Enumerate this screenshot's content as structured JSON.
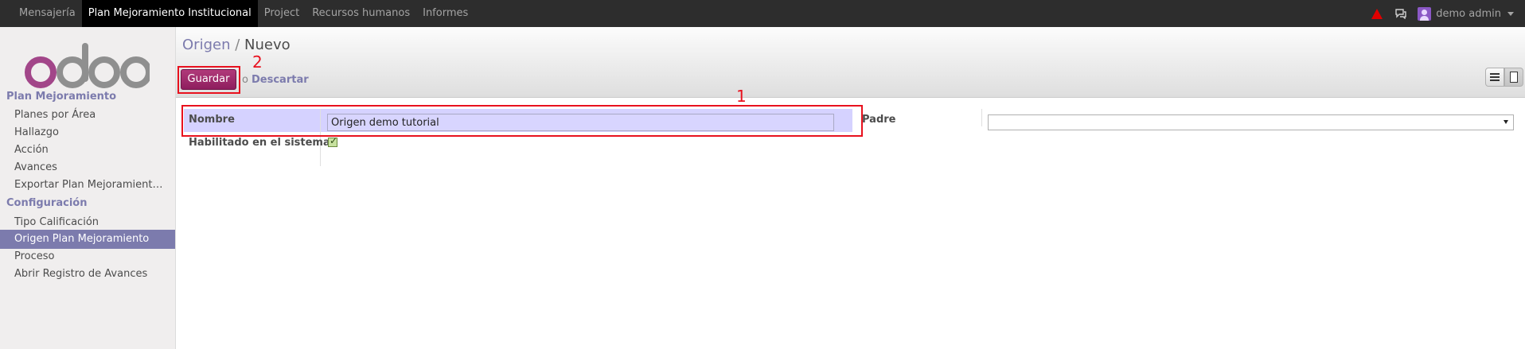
{
  "topbar": {
    "menu": [
      {
        "label": "Mensajería",
        "active": false
      },
      {
        "label": "Plan Mejoramiento Institucional",
        "active": true
      },
      {
        "label": "Project",
        "active": false
      },
      {
        "label": "Recursos humanos",
        "active": false
      },
      {
        "label": "Informes",
        "active": false
      }
    ],
    "user": "demo  admin",
    "icons": [
      "warning-icon",
      "chat-icon",
      "avatar",
      "chevron-down-icon"
    ]
  },
  "sidebar": {
    "logo": "odoo",
    "sections": [
      {
        "title": "Plan Mejoramiento",
        "items": [
          "Planes por Área",
          "Hallazgo",
          "Acción",
          "Avances",
          "Exportar Plan Mejoramient…"
        ]
      },
      {
        "title": "Configuración",
        "items": [
          "Tipo Calificación",
          "Origen Plan Mejoramiento",
          "Proceso",
          "Abrir Registro de Avances"
        ]
      }
    ],
    "active_item": "Origen Plan Mejoramiento"
  },
  "header": {
    "breadcrumb_parent": "Origen",
    "breadcrumb_sep": "/",
    "breadcrumb_current": "Nuevo",
    "save_label": "Guardar",
    "or_text": "o",
    "discard_label": "Descartar"
  },
  "annotations": {
    "box1": "1",
    "box2": "2"
  },
  "form": {
    "nombre_label": "Nombre",
    "nombre_value": "Origen demo tutorial",
    "habilitado_label": "Habilitado en el sistema?",
    "habilitado_checked": true,
    "padre_label": "Padre",
    "padre_value": ""
  },
  "colors": {
    "accent": "#7c7bad",
    "primary_button": "#9e2b6c",
    "annotation": "#e8111e",
    "topbar": "#2d2d2d"
  }
}
